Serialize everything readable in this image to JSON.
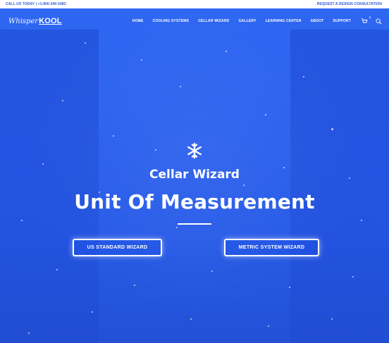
{
  "topbar": {
    "phone": "CALL US TODAY | +1-800-340-5483",
    "consult": "REQUEST A DESIGN CONSULTATION"
  },
  "logo": {
    "part1": "Whisper",
    "part2": "KOOL"
  },
  "nav": {
    "items": [
      "HOME",
      "COOLING SYSTEMS",
      "CELLAR WIZARD",
      "GALLERY",
      "LEARNING CENTER",
      "ABOUT",
      "SUPPORT"
    ],
    "cart_count": "0"
  },
  "hero": {
    "subtitle": "Cellar Wizard",
    "title": "Unit Of Measurement",
    "btn_us": "US STANDARD WIZARD",
    "btn_metric": "METRIC SYSTEM WIZARD"
  },
  "icons": {
    "cart": "cart-icon",
    "search": "search-icon",
    "snowflake": "snowflake-icon"
  },
  "colors": {
    "accent": "#2b59d8",
    "hero_bg": "#2a5fee",
    "text": "#ffffff"
  }
}
